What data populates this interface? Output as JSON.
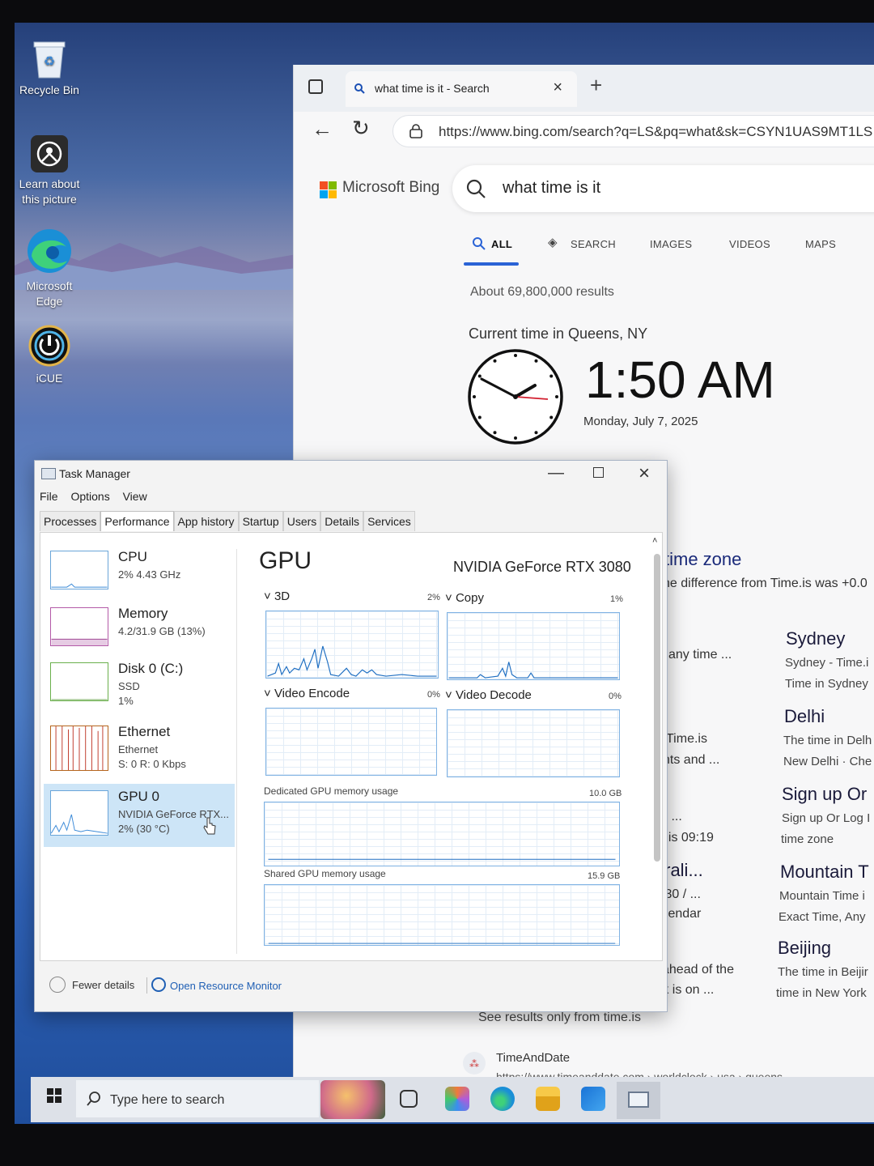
{
  "desktop": {
    "icons": [
      {
        "label": "Recycle Bin"
      },
      {
        "label": "Learn about this picture"
      },
      {
        "label": "Microsoft Edge"
      },
      {
        "label": "iCUE"
      }
    ]
  },
  "browser": {
    "tab_title": "what time is it - Search",
    "url": "https://www.bing.com/search?q=LS&pq=what&sk=CSYN1UAS9MT1LS",
    "bing": {
      "brand": "Microsoft Bing",
      "query": "what time is it",
      "tabs": [
        "ALL",
        "SEARCH",
        "IMAGES",
        "VIDEOS",
        "MAPS"
      ],
      "results_count": "About 69,800,000 results",
      "location_label": "Current time in Queens, NY",
      "time": "1:50 AM",
      "date": "Monday, July 7, 2025",
      "time_zone_heading": "time zone",
      "time_zone_text": "he difference from Time.is was +0.0",
      "fragments": [
        "any time ...",
        "Time.is",
        "nts and ...",
        "J ...",
        "riis 09:19",
        "trali...",
        ":30 / ...",
        "alendar",
        "ahead of the",
        "rk is on ..."
      ],
      "related": [
        {
          "head": "Sydney",
          "l1": "Sydney - Time.i",
          "l2": "Time in Sydney"
        },
        {
          "head": "Delhi",
          "l1": "The time in Delh",
          "l2": "New Delhi · Che"
        },
        {
          "head": "Sign up Or",
          "l1": "Sign up Or Log I",
          "l2": "time zone"
        },
        {
          "head": "Mountain T",
          "l1": "Mountain Time i",
          "l2": "Exact Time, Any"
        },
        {
          "head": "Beijing",
          "l1": "The time in Beijir",
          "l2": "time in New York"
        }
      ],
      "see_results": "See results only from time.is",
      "timeanddate_title": "TimeAndDate",
      "timeanddate_url": "https://www.timeanddate.com › worldclock › usa › queens"
    }
  },
  "task_manager": {
    "title": "Task Manager",
    "menu": [
      "File",
      "Options",
      "View"
    ],
    "tabs": [
      "Processes",
      "Performance",
      "App history",
      "Startup",
      "Users",
      "Details",
      "Services"
    ],
    "sidebar": [
      {
        "name": "CPU",
        "l2": "2% 4.43 GHz",
        "l3": ""
      },
      {
        "name": "Memory",
        "l2": "4.2/31.9 GB (13%)",
        "l3": ""
      },
      {
        "name": "Disk 0 (C:)",
        "l2": "SSD",
        "l3": "1%"
      },
      {
        "name": "Ethernet",
        "l2": "Ethernet",
        "l3": "S: 0 R: 0 Kbps"
      },
      {
        "name": "GPU 0",
        "l2": "NVIDIA GeForce RTX...",
        "l3": "2% (30 °C)"
      }
    ],
    "gpu": {
      "heading": "GPU",
      "model": "NVIDIA GeForce RTX 3080",
      "engines": [
        {
          "label": "3D",
          "pct": "2%"
        },
        {
          "label": "Copy",
          "pct": "1%"
        },
        {
          "label": "Video Encode",
          "pct": "0%"
        },
        {
          "label": "Video Decode",
          "pct": "0%"
        }
      ],
      "dedicated_label": "Dedicated GPU memory usage",
      "dedicated_max": "10.0 GB",
      "shared_label": "Shared GPU memory usage",
      "shared_max": "15.9 GB"
    },
    "footer": {
      "fewer": "Fewer details",
      "resource_monitor": "Open Resource Monitor"
    }
  },
  "taskbar": {
    "search_placeholder": "Type here to search"
  },
  "colors": {
    "accent": "#2a63d6",
    "selection": "#cde5f7",
    "graph_border": "#7fb2e3"
  }
}
